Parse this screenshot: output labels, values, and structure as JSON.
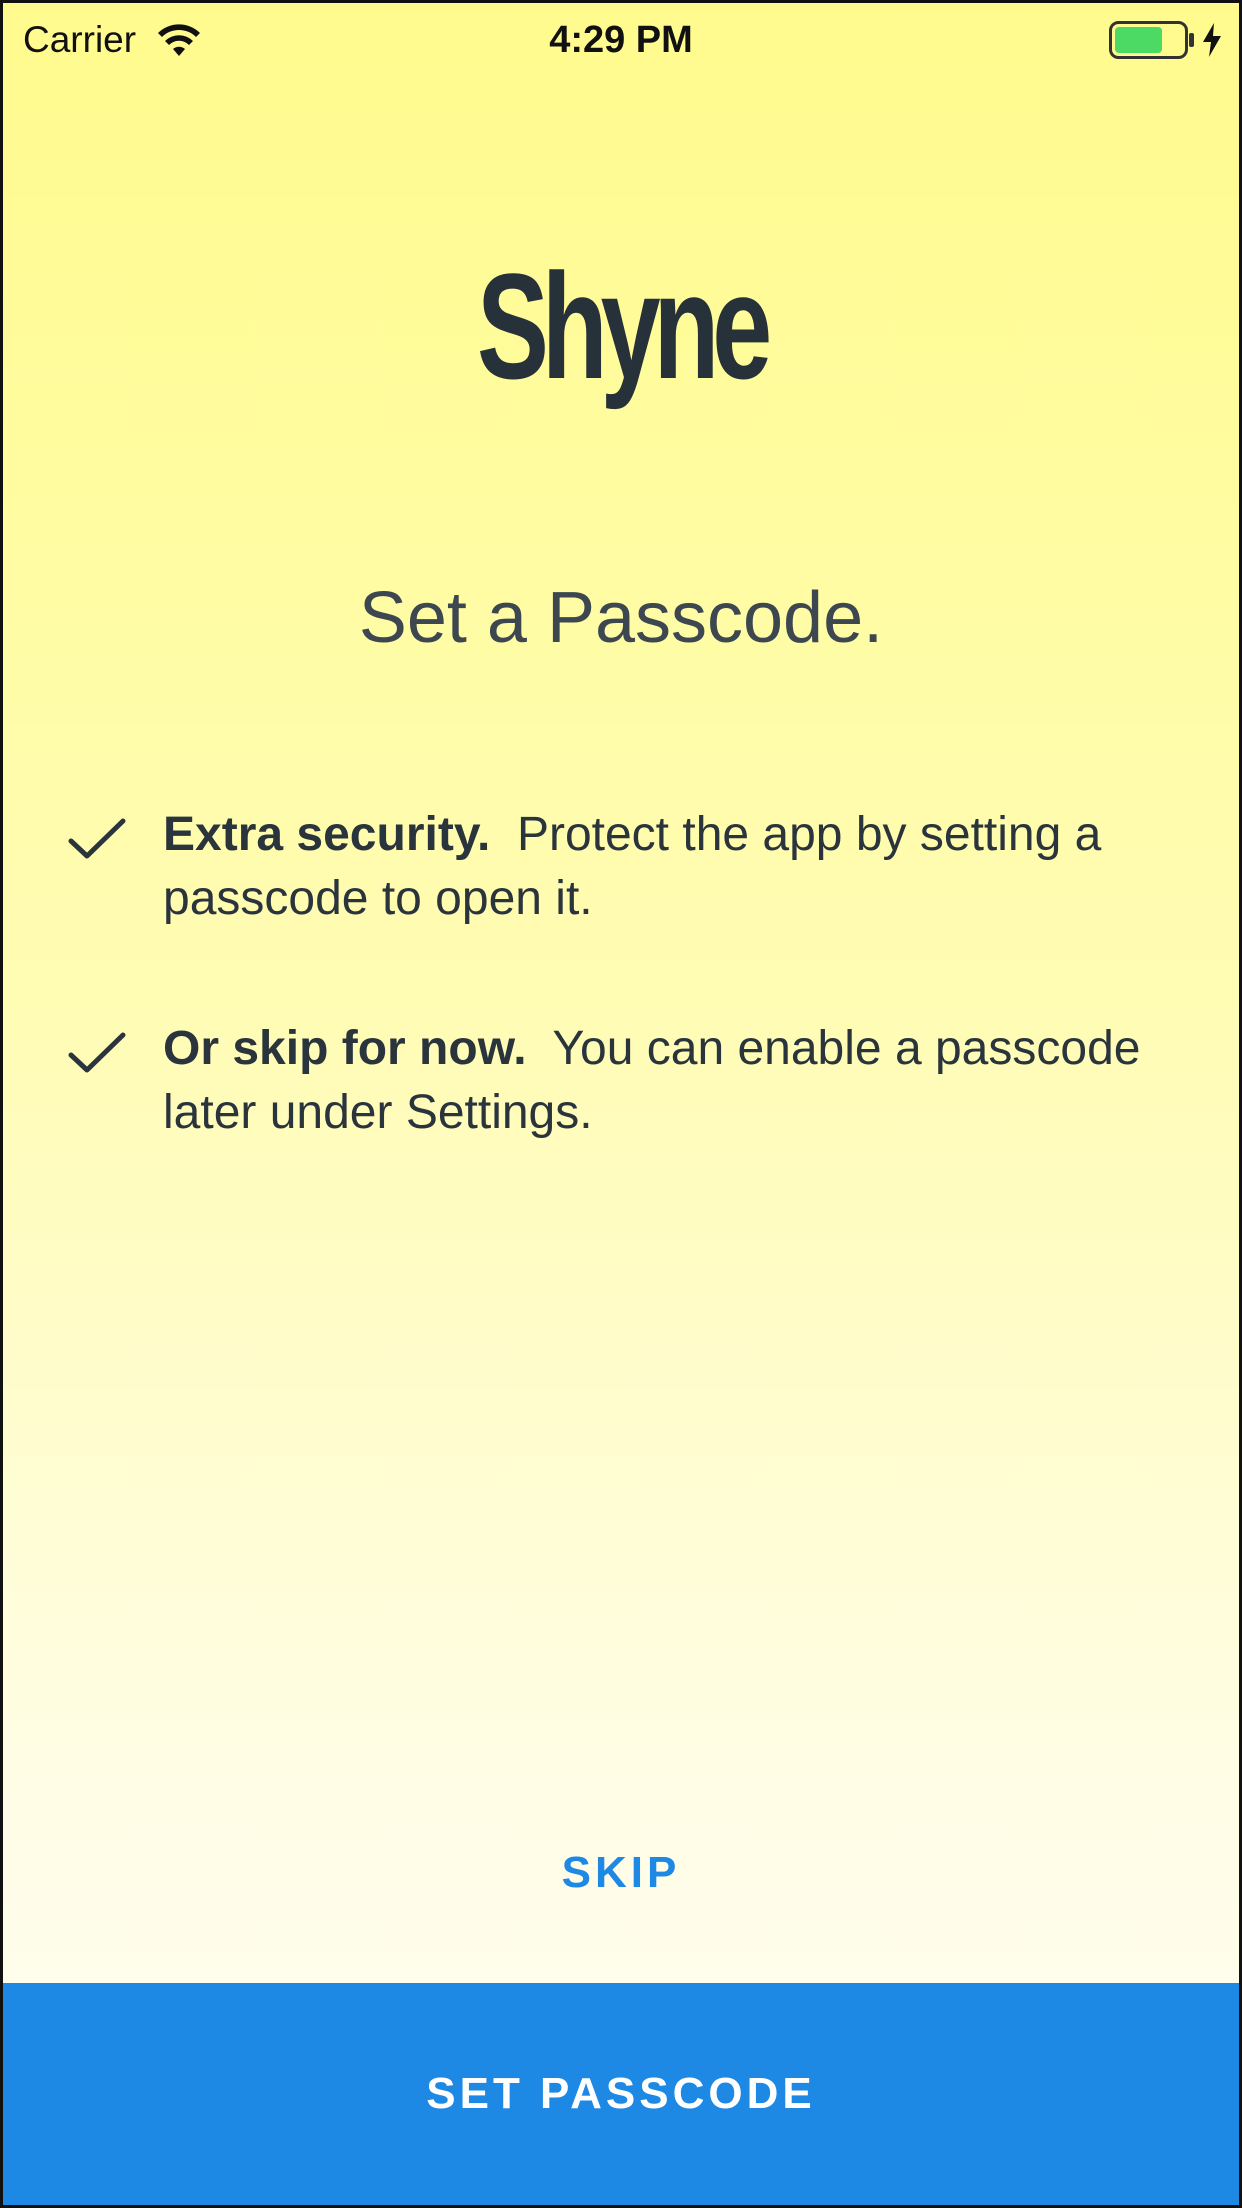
{
  "status_bar": {
    "carrier": "Carrier",
    "time": "4:29 PM",
    "wifi_icon": "wifi-icon",
    "battery_icon": "battery-icon",
    "charging_icon": "bolt-icon",
    "battery_level": 0.7,
    "battery_color": "#4cd964"
  },
  "logo": {
    "text": "Shyne"
  },
  "heading": "Set a Passcode.",
  "features": [
    {
      "icon": "check-icon",
      "title": "Extra security.",
      "description": "Protect the app by setting a passcode to open it."
    },
    {
      "icon": "check-icon",
      "title": "Or skip for now.",
      "description": "You can enable a passcode later under Settings."
    }
  ],
  "actions": {
    "skip_label": "SKIP",
    "primary_label": "SET PASSCODE"
  },
  "colors": {
    "background_top": "#fffb8d",
    "background_bottom": "#fffef4",
    "accent": "#1d89e4",
    "text_dark": "#26313a"
  }
}
